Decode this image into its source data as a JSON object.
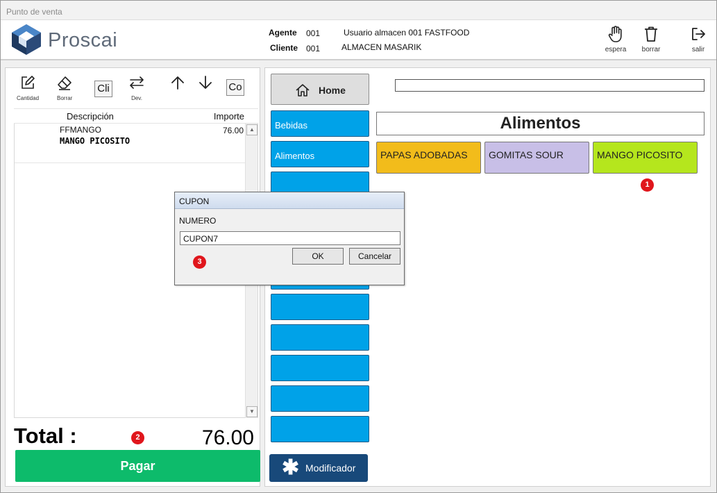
{
  "window": {
    "title": "Punto de venta"
  },
  "header": {
    "brand": "Proscai",
    "agente_label": "Agente",
    "agente_value": "001",
    "agente_name": "Usuario almacen 001 FASTFOOD",
    "cliente_label": "Cliente",
    "cliente_value": "001",
    "cliente_name": "ALMACEN MASARIK",
    "tools": [
      {
        "label": "espera",
        "icon": "hand-icon"
      },
      {
        "label": "borrar",
        "icon": "trash-icon"
      },
      {
        "label": "salir",
        "icon": "exit-icon"
      }
    ]
  },
  "left_panel": {
    "toolbar": {
      "cantidad": "Cantidad",
      "borrar": "Borrar",
      "cli": "Cli",
      "dev": "Dev.",
      "co": "Co"
    },
    "table": {
      "col_descripcion": "Descripción",
      "col_importe": "Importe",
      "rows": [
        {
          "code": "FFMANGO",
          "name": "MANGO PICOSITO",
          "importe": "76.00"
        }
      ]
    },
    "total_label": "Total :",
    "total_value": "76.00",
    "pagar": "Pagar"
  },
  "right_panel": {
    "home": "Home",
    "categories": [
      "Bebidas",
      "Alimentos",
      "",
      "",
      "",
      "",
      "",
      "",
      "",
      "",
      ""
    ],
    "modificador": "Modificador",
    "category_title": "Alimentos",
    "products": [
      {
        "name": "PAPAS ADOBADAS",
        "color": "#f2bc1b"
      },
      {
        "name": "GOMITAS SOUR",
        "color": "#c8bfe7"
      },
      {
        "name": "MANGO PICOSITO",
        "color": "#b5e61d"
      }
    ]
  },
  "dialog": {
    "title": "CUPON",
    "label": "NUMERO",
    "input_value": "CUPON7",
    "ok": "OK",
    "cancel": "Cancelar"
  },
  "markers": [
    "1",
    "2",
    "3"
  ],
  "colors": {
    "accent_blue": "#00a2e8",
    "pagar_green": "#0dbb6b",
    "modificador_navy": "#18497a",
    "marker_red": "#e0161c"
  }
}
